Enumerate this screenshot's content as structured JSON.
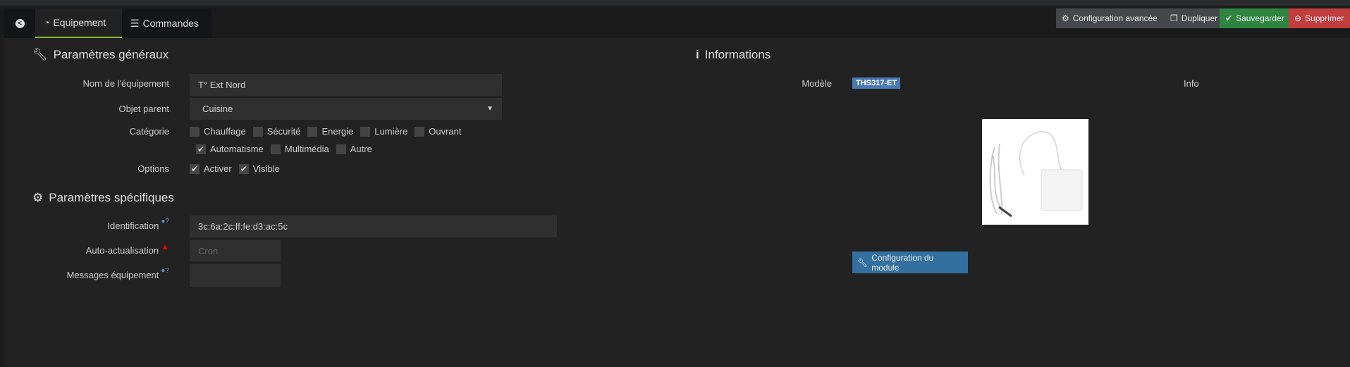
{
  "tabs": {
    "back": "back",
    "equipement": "Equipement",
    "commandes": "Commandes"
  },
  "actions": {
    "config": "Configuration avancée",
    "dupliquer": "Dupliquer",
    "sauvegarder": "Sauvegarder",
    "supprimer": "Supprimer"
  },
  "general": {
    "title": "Paramètres généraux",
    "name_label": "Nom de l'équipement",
    "name_value": "T° Ext Nord",
    "parent_label": "Objet parent",
    "parent_value": "Cuisine",
    "category_label": "Catégorie",
    "categories": [
      {
        "label": "Chauffage",
        "checked": false
      },
      {
        "label": "Sécurité",
        "checked": false
      },
      {
        "label": "Energie",
        "checked": false
      },
      {
        "label": "Lumière",
        "checked": false
      },
      {
        "label": "Ouvrant",
        "checked": false
      },
      {
        "label": "Automatisme",
        "checked": true
      },
      {
        "label": "Multimédia",
        "checked": false
      },
      {
        "label": "Autre",
        "checked": false
      }
    ],
    "options_label": "Options",
    "options": [
      {
        "label": "Activer",
        "checked": true
      },
      {
        "label": "Visible",
        "checked": true
      }
    ]
  },
  "specific": {
    "title": "Paramètres spécifiques",
    "id_label": "Identification",
    "id_value": "3c:6a:2c:ff:fe:d3:ac:5c",
    "auto_label": "Auto-actualisation",
    "auto_placeholder": "Cron",
    "msg_label": "Messages équipement",
    "msg_value": ""
  },
  "info": {
    "title": "Informations",
    "model_label": "Modèle",
    "model_value": "THS317-ET",
    "info_label": "Info",
    "module_button": "Configuration du module"
  },
  "colors": {
    "accent": "#8bb33a",
    "save": "#2e8540",
    "delete": "#c13d3e",
    "badge": "#4a7ab5",
    "primary": "#33709f"
  }
}
